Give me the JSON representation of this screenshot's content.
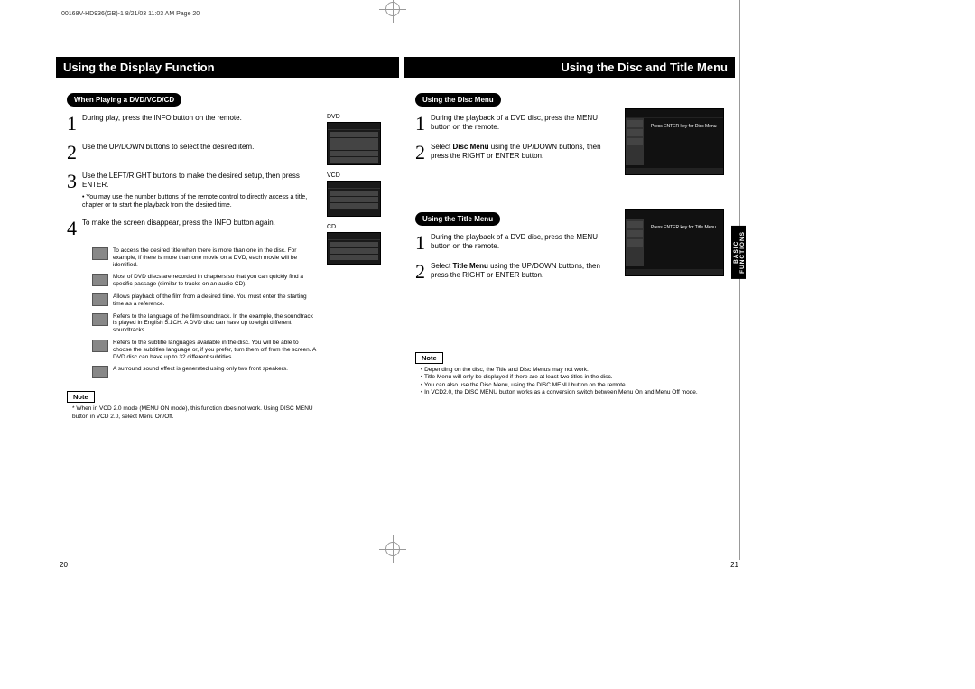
{
  "print_header": "00168V-HD936(GB)-1  8/21/03  11:03 AM  Page 20",
  "left": {
    "title": "Using the Display Function",
    "subhead": "When Playing a DVD/VCD/CD",
    "steps": [
      {
        "num": "1",
        "text": "During play, press the INFO button on the remote."
      },
      {
        "num": "2",
        "text": "Use the UP/DOWN buttons to select the desired item."
      },
      {
        "num": "3",
        "text": "Use the LEFT/RIGHT buttons to make the desired setup, then press ENTER.",
        "sub": "• You may use the number buttons of the remote control to directly access a title, chapter or to start the playback from the desired time."
      },
      {
        "num": "4",
        "text": "To make the screen disappear, press the INFO button again."
      }
    ],
    "icons": [
      {
        "label": "Title",
        "text": "To access the desired title when there is more than one in the disc. For example, if there is more than one movie on a DVD, each movie will be identified."
      },
      {
        "label": "Chapter",
        "text": "Most of DVD discs are recorded in chapters so that you can quickly find a specific passage (similar to tracks on an audio CD)."
      },
      {
        "label": "Time",
        "text": "Allows playback of the film from a desired time. You must enter the starting time as a reference."
      },
      {
        "label": "Audio",
        "text": "Refers to the language of the film soundtrack. In the example, the soundtrack is played in English 5.1CH. A DVD disc can have up to eight different soundtracks."
      },
      {
        "label": "Subtitle",
        "text": "Refers to the subtitle languages available in the disc. You will be able to choose the subtitles language or, if you prefer, turn them off from the screen. A DVD disc can have up to 32 different subtitles."
      },
      {
        "label": "Sound",
        "text": "A surround sound effect is generated using only two front speakers."
      }
    ],
    "side_labels": {
      "dvd": "DVD",
      "vcd": "VCD",
      "cd": "CD"
    },
    "note_head": "Note",
    "note_text": "* When in VCD 2.0 mode (MENU ON mode), this function does not work. Using DISC MENU button in VCD 2.0, select Menu On/Off.",
    "page_no": "20"
  },
  "right": {
    "title": "Using the Disc and Title Menu",
    "disc": {
      "subhead": "Using the Disc Menu",
      "steps": [
        {
          "num": "1",
          "text": "During the playback of a DVD disc, press the MENU button on the remote."
        },
        {
          "num": "2",
          "text_pre": "Select ",
          "text_bold": "Disc Menu",
          "text_post": " using the UP/DOWN buttons, then press the RIGHT or ENTER button."
        }
      ],
      "shot_msg": "Press ENTER key for Disc Menu"
    },
    "title_menu": {
      "subhead": "Using the Title Menu",
      "steps": [
        {
          "num": "1",
          "text": "During the playback of a DVD disc, press the MENU button on the remote."
        },
        {
          "num": "2",
          "text_pre": "Select ",
          "text_bold": "Title Menu",
          "text_post": " using the UP/DOWN buttons, then press the RIGHT or ENTER button."
        }
      ],
      "shot_msg": "Press ENTER key for Title Menu"
    },
    "note_head": "Note",
    "notes": [
      "Depending on the disc, the Title and Disc Menus may not work.",
      "Title Menu will only be displayed if there are at least two titles in the disc.",
      "You can also use the Disc Menu, using the DISC MENU button on the remote.",
      "In VCD2.0, the DISC MENU button works as a conversion switch between Menu On and Menu Off mode."
    ],
    "page_no": "21",
    "side_tab_line1": "BASIC",
    "side_tab_line2": "FUNCTIONS"
  }
}
